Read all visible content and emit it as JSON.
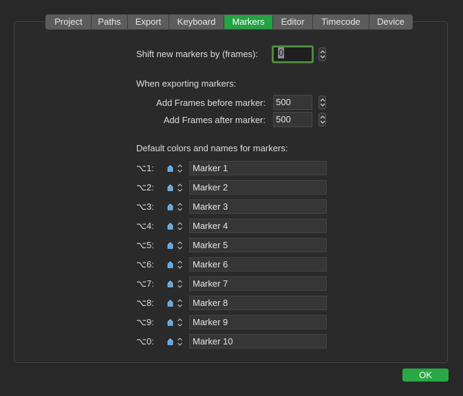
{
  "tabs": [
    {
      "label": "Project",
      "active": false
    },
    {
      "label": "Paths",
      "active": false
    },
    {
      "label": "Export",
      "active": false
    },
    {
      "label": "Keyboard",
      "active": false
    },
    {
      "label": "Markers",
      "active": true
    },
    {
      "label": "Editor",
      "active": false
    },
    {
      "label": "Timecode",
      "active": false
    },
    {
      "label": "Device",
      "active": false
    }
  ],
  "shift": {
    "label": "Shift new markers by (frames):",
    "value": "0"
  },
  "exporting": {
    "heading": "When exporting markers:",
    "before_label": "Add Frames before marker:",
    "before_value": "500",
    "after_label": "Add Frames after marker:",
    "after_value": "500"
  },
  "defaults": {
    "heading": "Default colors and names for markers:",
    "marker_color": "#5aa8e6",
    "rows": [
      {
        "key": "⌥1:",
        "name": "Marker 1"
      },
      {
        "key": "⌥2:",
        "name": "Marker 2"
      },
      {
        "key": "⌥3:",
        "name": "Marker 3"
      },
      {
        "key": "⌥4:",
        "name": "Marker 4"
      },
      {
        "key": "⌥5:",
        "name": "Marker 5"
      },
      {
        "key": "⌥6:",
        "name": "Marker 6"
      },
      {
        "key": "⌥7:",
        "name": "Marker 7"
      },
      {
        "key": "⌥8:",
        "name": "Marker 8"
      },
      {
        "key": "⌥9:",
        "name": "Marker 9"
      },
      {
        "key": "⌥0:",
        "name": "Marker 10"
      }
    ]
  },
  "ok_label": "OK",
  "colors": {
    "accent": "#29a845",
    "background": "#282828"
  }
}
